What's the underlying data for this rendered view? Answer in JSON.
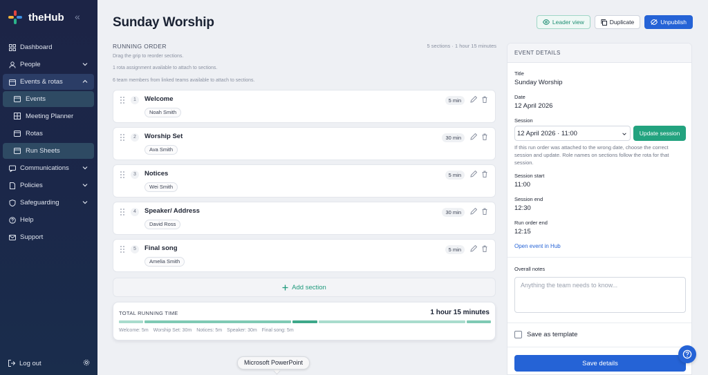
{
  "app": {
    "name": "theHub"
  },
  "sidebar": {
    "items": [
      {
        "label": "Dashboard"
      },
      {
        "label": "People"
      },
      {
        "label": "Events & rotas"
      },
      {
        "label": "Communications"
      },
      {
        "label": "Policies"
      },
      {
        "label": "Safeguarding"
      },
      {
        "label": "Help"
      },
      {
        "label": "Support"
      }
    ],
    "sub_items": [
      {
        "label": "Events"
      },
      {
        "label": "Meeting Planner"
      },
      {
        "label": "Rotas"
      },
      {
        "label": "Run Sheets"
      }
    ],
    "logout": "Log out"
  },
  "header": {
    "title": "Sunday Worship",
    "leader_view": "Leader view",
    "duplicate": "Duplicate",
    "unpublish": "Unpublish"
  },
  "running_order": {
    "title": "RUNNING ORDER",
    "meta": "5 sections · 1 hour 15 minutes",
    "hints": [
      "Drag the grip to reorder sections.",
      "1 rota assignment available to attach to sections.",
      "6 team members from linked teams available to attach to sections."
    ],
    "sections": [
      {
        "num": "1",
        "name": "Welcome",
        "person": "Noah Smith",
        "duration": "5 min"
      },
      {
        "num": "2",
        "name": "Worship Set",
        "person": "Ava Smith",
        "duration": "30 min"
      },
      {
        "num": "3",
        "name": "Notices",
        "person": "Wei Smith",
        "duration": "5 min"
      },
      {
        "num": "4",
        "name": "Speaker/ Address",
        "person": "David Ross",
        "duration": "30 min"
      },
      {
        "num": "5",
        "name": "Final song",
        "person": "Amelia Smith",
        "duration": "5 min"
      }
    ],
    "add_section": "Add section"
  },
  "total": {
    "label": "TOTAL RUNNING TIME",
    "value": "1 hour 15 minutes",
    "segments": [
      {
        "minutes": 5,
        "color": "#a9dccd"
      },
      {
        "minutes": 30,
        "color": "#7fcab4"
      },
      {
        "minutes": 5,
        "color": "#3ea88a"
      },
      {
        "minutes": 30,
        "color": "#a9dccd"
      },
      {
        "minutes": 5,
        "color": "#7fcab4"
      }
    ],
    "legend": [
      "Welcome: 5m",
      "Worship Set: 30m",
      "Notices: 5m",
      "Speaker: 30m",
      "Final song: 5m"
    ]
  },
  "details": {
    "title": "EVENT DETAILS",
    "title_label": "Title",
    "title_value": "Sunday Worship",
    "date_label": "Date",
    "date_value": "12 April 2026",
    "session_label": "Session",
    "session_value": "12 April 2026 · 11:00",
    "update_session": "Update session",
    "session_help": "If this run order was attached to the wrong date, choose the correct session and update. Role names on sections follow the rota for that session.",
    "session_start_label": "Session start",
    "session_start_value": "11:00",
    "session_end_label": "Session end",
    "session_end_value": "12:30",
    "run_order_end_label": "Run order end",
    "run_order_end_value": "12:15",
    "open_event_link": "Open event in Hub",
    "notes_label": "Overall notes",
    "notes_placeholder": "Anything the team needs to know...",
    "save_template": "Save as template",
    "save_details": "Save details"
  },
  "tooltip": "Microsoft PowerPoint",
  "colors": {
    "accent_blue": "#2563d6",
    "accent_green": "#23a37f",
    "sidebar_bg": "#1c2446"
  }
}
